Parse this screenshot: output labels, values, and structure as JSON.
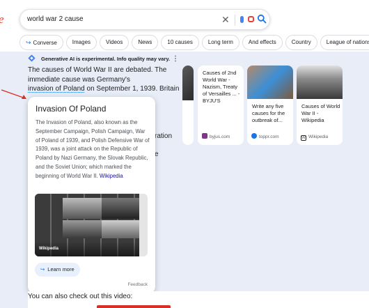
{
  "search": {
    "logo_fragment": "e",
    "query": "world war 2 cause"
  },
  "chips": [
    {
      "label": "Converse",
      "icon": "converse-icon"
    },
    {
      "label": "Images"
    },
    {
      "label": "Videos"
    },
    {
      "label": "News"
    },
    {
      "label": "10 causes"
    },
    {
      "label": "Long term"
    },
    {
      "label": "And effects"
    },
    {
      "label": "Country"
    },
    {
      "label": "League of nations"
    }
  ],
  "ai": {
    "header": "Generative AI is experimental. Info quality may vary.",
    "text_line1": "The causes of World War II are debated. The",
    "text_line2": "immediate cause was Germany's",
    "text_link": "invasion of Poland",
    "text_line3_rest": " on September 1, 1939. Britain",
    "frag_ration": "ration",
    "frag_e": "e"
  },
  "cards": [
    {
      "title": "Causes of 2nd World War - Nazism, Treaty of Versailles ... - BYJU'S",
      "source": "byjus.com",
      "fav_color": "#813588"
    },
    {
      "title": "Write any five causes for the outbreak of...",
      "source": "toppr.com",
      "fav_color": "#1a73e8"
    },
    {
      "title": "Causes of World War II - Wikipedia",
      "source": "Wikipedia",
      "fav_color": "#202124"
    }
  ],
  "popup": {
    "title": "Invasion Of Poland",
    "body": "The Invasion of Poland, also known as the September Campaign, Polish Campaign, War of Poland of 1939, and Polish Defensive War of 1939, was a joint attack on the Republic of Poland by Nazi Germany, the Slovak Republic, and the Soviet Union; which marked the beginning of World War II.",
    "body_link": "Wikipedia",
    "image_label": "Wikipedia",
    "learn_more": "Learn more",
    "feedback": "Feedback"
  },
  "footer": {
    "also": "You can also check out this video:"
  },
  "colors": {
    "accent": "#1a73e8",
    "panel": "#e8edf7",
    "arrow": "#d93025"
  }
}
